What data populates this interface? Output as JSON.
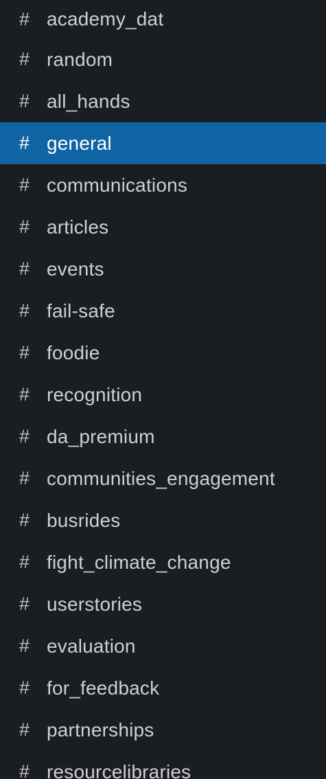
{
  "sidebar": {
    "hash_glyph": "#",
    "active_color": "#1164a3",
    "background_color": "#1a1d21",
    "channels": [
      {
        "name": "academy_dat",
        "active": false
      },
      {
        "name": "random",
        "active": false
      },
      {
        "name": "all_hands",
        "active": false
      },
      {
        "name": "general",
        "active": true
      },
      {
        "name": "communications",
        "active": false
      },
      {
        "name": "articles",
        "active": false
      },
      {
        "name": "events",
        "active": false
      },
      {
        "name": "fail-safe",
        "active": false
      },
      {
        "name": "foodie",
        "active": false
      },
      {
        "name": "recognition",
        "active": false
      },
      {
        "name": "da_premium",
        "active": false
      },
      {
        "name": "communities_engagement",
        "active": false
      },
      {
        "name": "busrides",
        "active": false
      },
      {
        "name": "fight_climate_change",
        "active": false
      },
      {
        "name": "userstories",
        "active": false
      },
      {
        "name": "evaluation",
        "active": false
      },
      {
        "name": "for_feedback",
        "active": false
      },
      {
        "name": "partnerships",
        "active": false
      },
      {
        "name": "resourcelibraries",
        "active": false
      }
    ]
  }
}
